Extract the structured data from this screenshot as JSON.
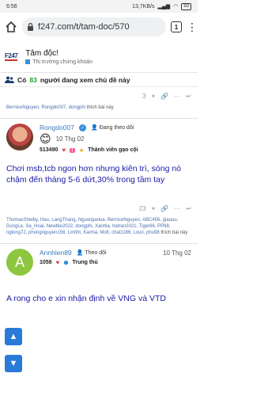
{
  "status_bar": {
    "time": "6:56",
    "network": "13,7KB/s",
    "battery": "93"
  },
  "browser": {
    "url": "f247.com/t/tam-doc/570",
    "tab_count": "1"
  },
  "site": {
    "logo": "F247",
    "topic_title": "Tâm độc!",
    "category": "Thị trường chứng khoán"
  },
  "viewers": {
    "prefix": "Có",
    "count": "83",
    "suffix": "người đang xem chủ đề này"
  },
  "post1": {
    "like_count": "3",
    "likers": "BerniceNguyen, Rongdo007, dongphi",
    "likers_suffix": " thích bài này"
  },
  "post2": {
    "author": "Rongdo007",
    "follow_label": "Đang theo dõi",
    "date": "10 Thg 02",
    "score": "513490",
    "rank_badge": "1",
    "rank_label": "Thành viên gạo cội",
    "body": "Chơi msb,tcb ngon hơn nhưng kiên trì, sóng nó chậm đến tháng 5-6 dứt,30% trong tầm tay",
    "like_count": "23",
    "likers": "ThomasShelby, Hao, LangThang, Nguoiquelua, BerniceNguyen, ABC456, giauuu, DungLe, Sa_Hoai, Newbie2022, dongphi, Xanhla, hatran2021, Tiger86, PP88, nglong72, phongnguyen156, Linhht, Karma, Mofi, chat1186, Lxuri, phu98",
    "likers_suffix": " thích bài này"
  },
  "post3": {
    "avatar_letter": "A",
    "author": "Annhien89",
    "follow_label": "Theo dõi",
    "date": "10 Thg 02",
    "score": "1058",
    "rank_label": "Trung thủ",
    "body": "A rong cho e xin nhận định về VNG và VTD"
  },
  "colors": {
    "accent": "#2a7ad8",
    "likers": "#4a6fb0",
    "body_text": "#1a1aa8"
  }
}
